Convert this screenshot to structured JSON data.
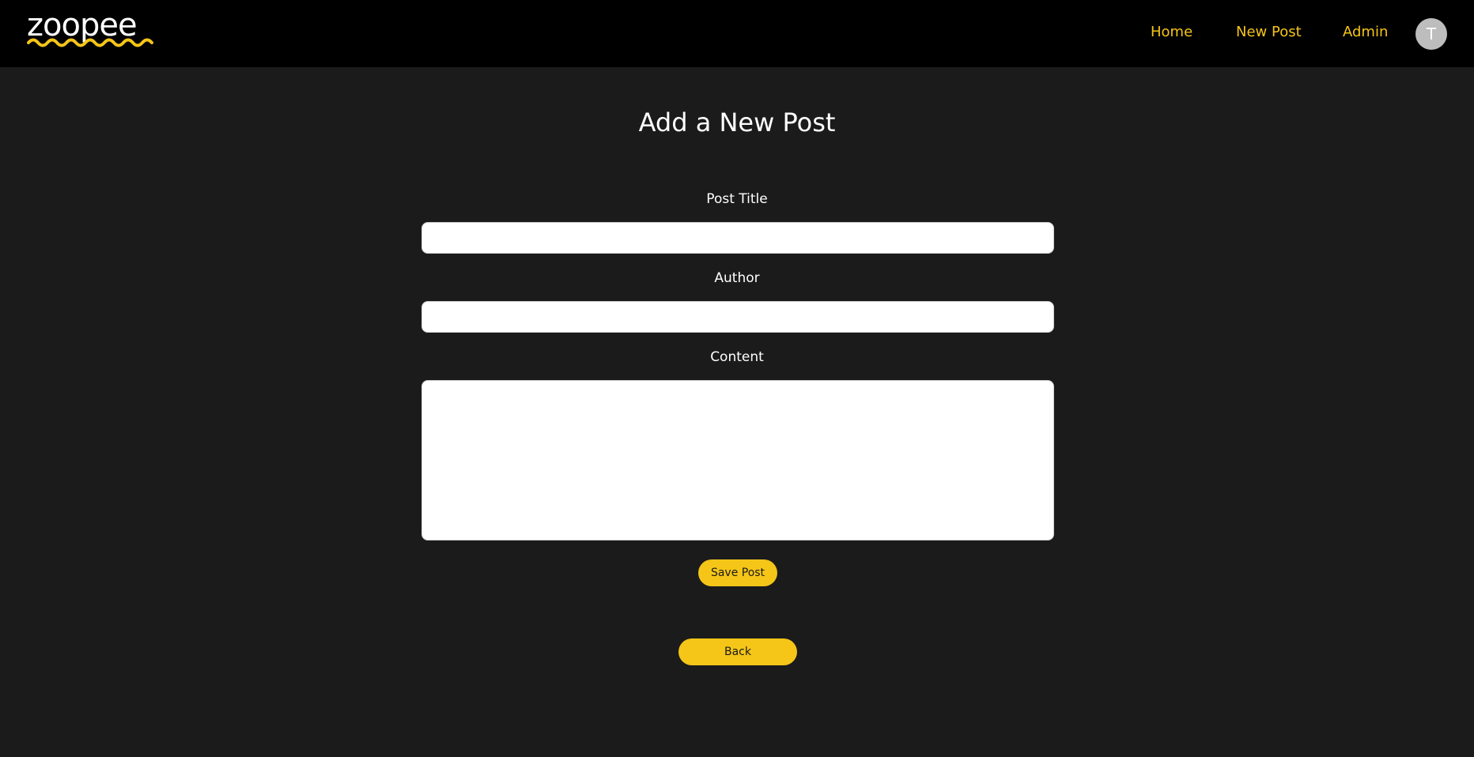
{
  "brand": {
    "logo_text": "zoopee",
    "accent_color": "#f5c518"
  },
  "nav": {
    "home": "Home",
    "new_post": "New Post",
    "admin": "Admin",
    "avatar_initial": "T"
  },
  "page": {
    "title": "Add a New Post"
  },
  "form": {
    "post_title_label": "Post Title",
    "post_title_value": "",
    "author_label": "Author",
    "author_value": "",
    "content_label": "Content",
    "content_value": "",
    "save_label": "Save Post"
  },
  "footer_actions": {
    "back_label": "Back"
  }
}
